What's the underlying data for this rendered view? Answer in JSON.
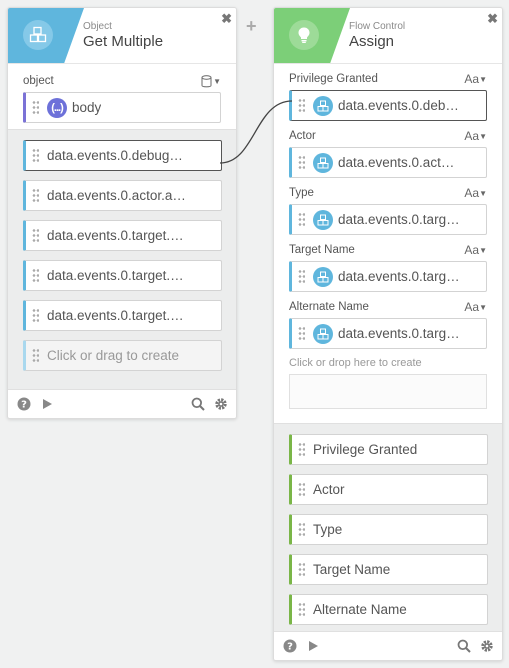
{
  "left_node": {
    "category": "Object",
    "title": "Get Multiple",
    "input_label": "object",
    "input_value": "body",
    "input_badge": "(...)",
    "outputs": [
      "data.events.0.debug…",
      "data.events.0.actor.a…",
      "data.events.0.target.…",
      "data.events.0.target.…",
      "data.events.0.target.…"
    ],
    "create_placeholder": "Click or drag to create"
  },
  "right_node": {
    "category": "Flow Control",
    "title": "Assign",
    "fields": [
      {
        "label": "Privilege Granted",
        "value": "data.events.0.deb…",
        "type_toggle": "Aa"
      },
      {
        "label": "Actor",
        "value": "data.events.0.act…",
        "type_toggle": "Aa"
      },
      {
        "label": "Type",
        "value": "data.events.0.targ…",
        "type_toggle": "Aa"
      },
      {
        "label": "Target Name",
        "value": "data.events.0.targ…",
        "type_toggle": "Aa"
      },
      {
        "label": "Alternate Name",
        "value": "data.events.0.targ…",
        "type_toggle": "Aa"
      }
    ],
    "drop_hint": "Click or drop here to create",
    "outputs": [
      "Privilege Granted",
      "Actor",
      "Type",
      "Target Name",
      "Alternate Name"
    ]
  },
  "connector_symbol": "+",
  "close_symbol": "✖",
  "colors": {
    "object_header": "#5fb6dd",
    "flow_control_header": "#7ccf78",
    "output_bar": "#7ab648",
    "variable_badge": "#6d71d9"
  }
}
